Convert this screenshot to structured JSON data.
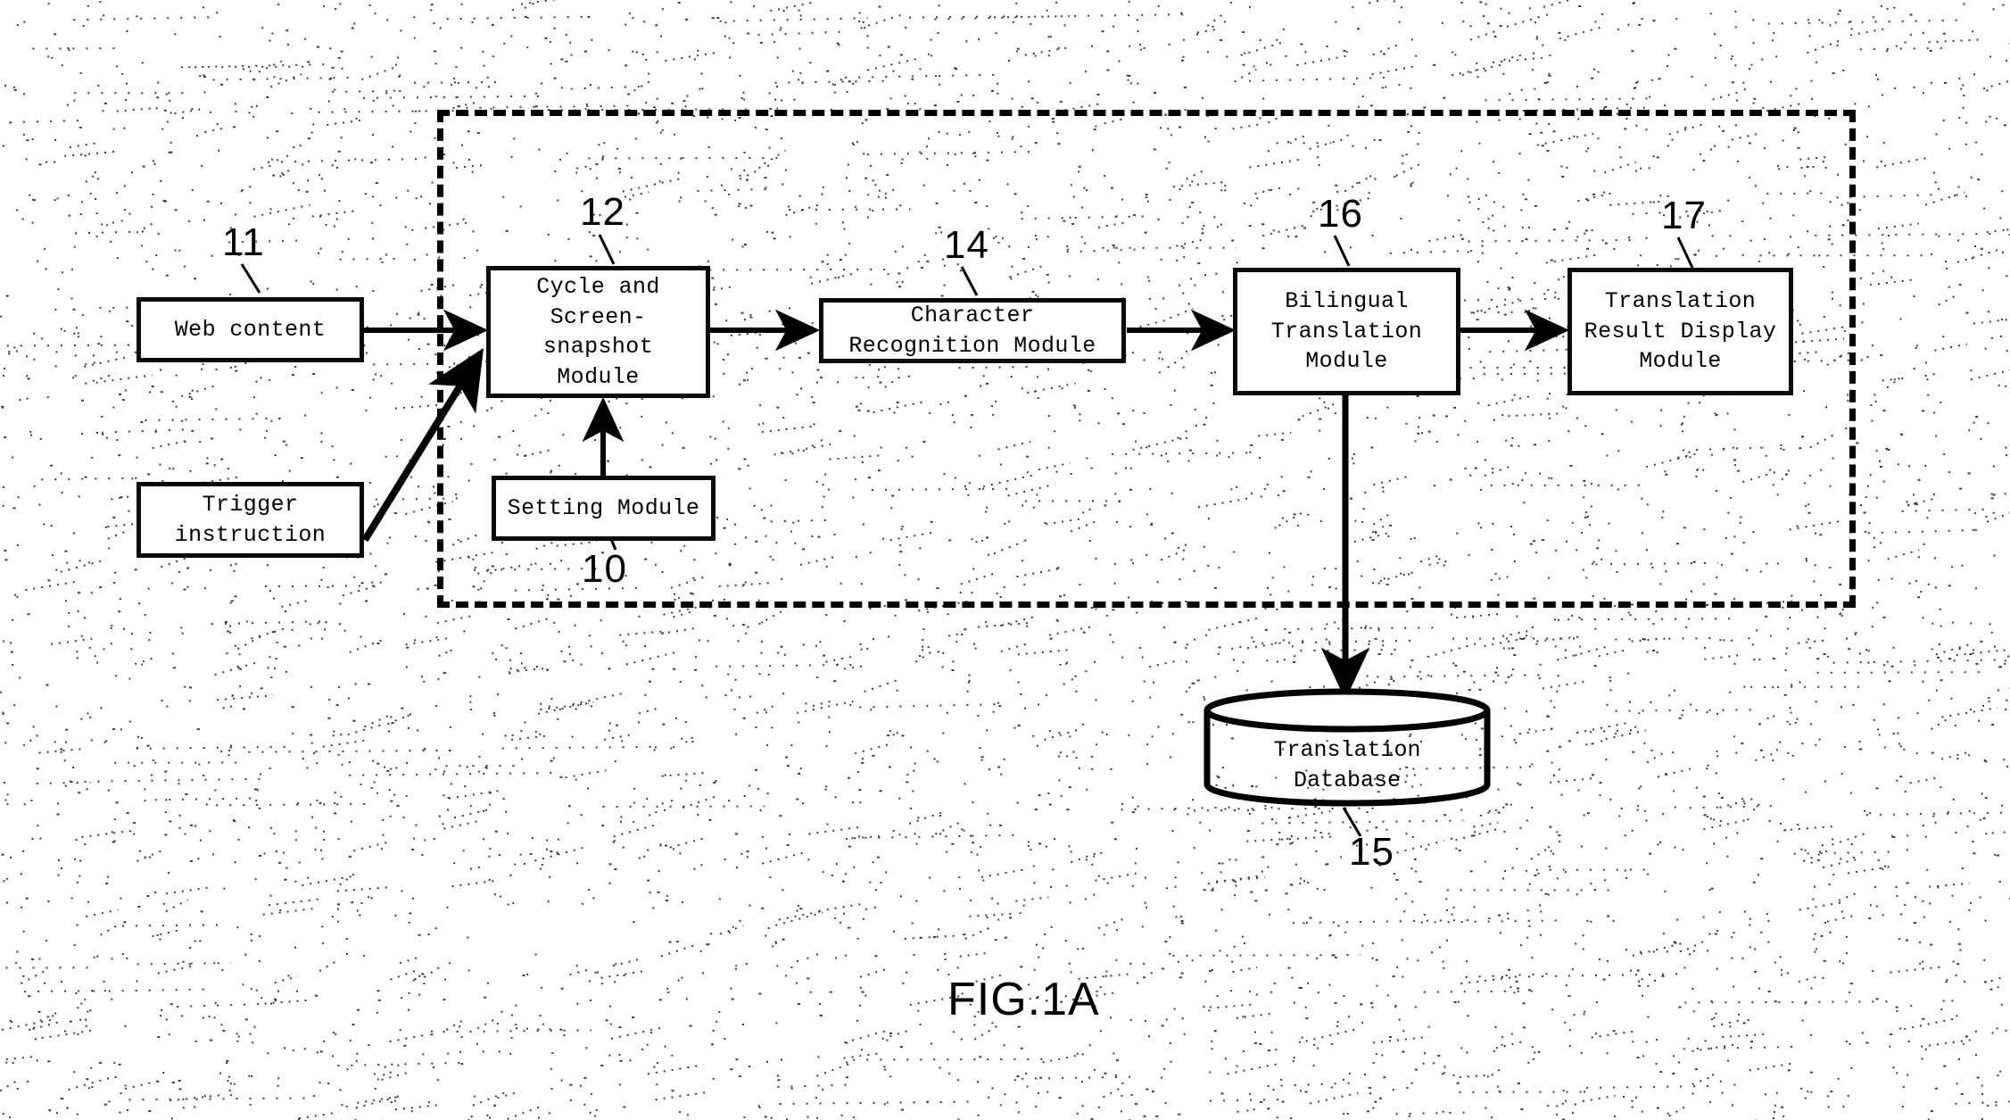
{
  "figure": {
    "caption": "FIG.1A",
    "title": "FIG.1A"
  },
  "nodes": {
    "web_content": {
      "label": "Web content",
      "numeral": "11"
    },
    "trigger": {
      "label": "Trigger\ninstruction",
      "numeral": ""
    },
    "cycle_snapshot": {
      "label": "Cycle and\nScreen-snapshot\nModule",
      "numeral": "12"
    },
    "setting": {
      "label": "Setting Module",
      "numeral": "10"
    },
    "character_recog": {
      "label": "Character\nRecognition Module",
      "numeral": "14"
    },
    "bilingual": {
      "label": "Bilingual\nTranslation\nModule",
      "numeral": "16"
    },
    "result_display": {
      "label": "Translation\nResult Display\nModule",
      "numeral": "17"
    },
    "database": {
      "label": "Translation\nDatabase",
      "numeral": "15"
    }
  },
  "colors": {
    "ink": "#000000",
    "paper": "#ffffff",
    "speckle": "#1a1a1a"
  }
}
